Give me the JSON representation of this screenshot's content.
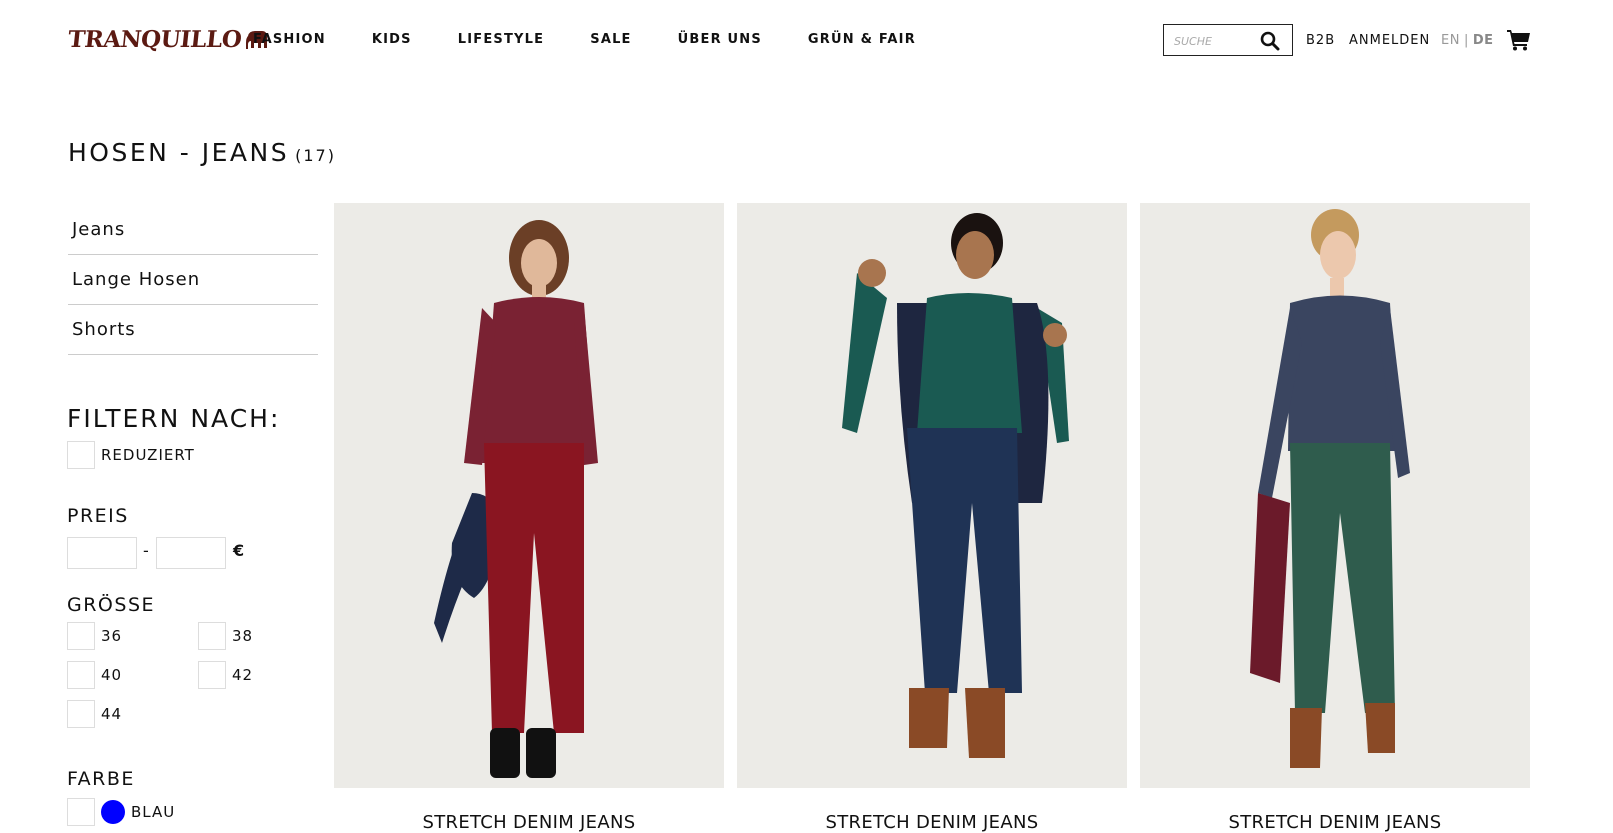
{
  "header": {
    "logo_text": "TRANQUILLO",
    "nav": [
      "FASHION",
      "KIDS",
      "LIFESTYLE",
      "SALE",
      "ÜBER UNS",
      "GRÜN & FAIR"
    ],
    "search_placeholder": "SUCHE",
    "b2b": "B2B",
    "login": "ANMELDEN",
    "lang_en": "EN",
    "lang_sep": "|",
    "lang_de": "DE"
  },
  "page": {
    "title": "HOSEN - JEANS",
    "count": "(17)"
  },
  "categories": [
    "Jeans",
    "Lange Hosen",
    "Shorts"
  ],
  "filters": {
    "heading": "FILTERN NACH:",
    "reduced_label": "REDUZIERT",
    "price_label": "PREIS",
    "price_dash": "-",
    "currency": "€",
    "size_label": "GRÖSSE",
    "sizes": [
      "36",
      "38",
      "40",
      "42",
      "44"
    ],
    "color_label": "FARBE",
    "colors": [
      {
        "name": "BLAU",
        "hex": "#0000ff"
      }
    ]
  },
  "products": [
    {
      "title": "STRETCH DENIM JEANS",
      "top_color": "#7a2233",
      "pants_color": "#8a1521",
      "skin": "#e0b89a",
      "hair": "#6b3f26"
    },
    {
      "title": "STRETCH DENIM JEANS",
      "top_color": "#1a5a52",
      "pants_color": "#1f3355",
      "skin": "#a8754f",
      "hair": "#1a1210"
    },
    {
      "title": "STRETCH DENIM JEANS",
      "top_color": "#3a4560",
      "pants_color": "#2f5c4d",
      "skin": "#ecc8ad",
      "hair": "#c49a5e"
    }
  ]
}
